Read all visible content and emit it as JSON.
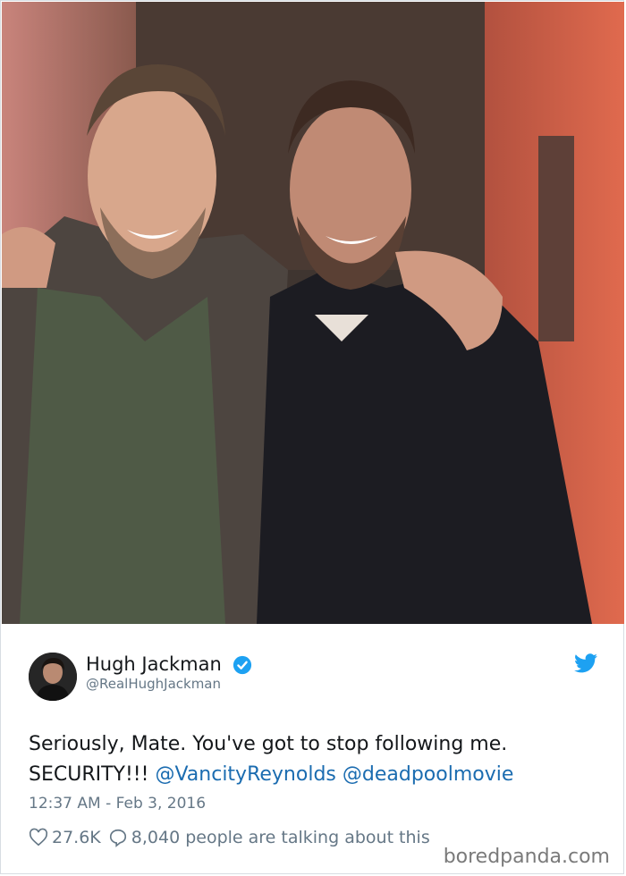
{
  "photo": {
    "alt_icon": "photo-two-men"
  },
  "tweet": {
    "display_name": "Hugh Jackman",
    "handle": "@RealHughJackman",
    "text_part1": "Seriously, Mate. You've got to stop following me.",
    "text_part2": "SECURITY!!!",
    "mention1": "@VancityReynolds",
    "mention2": "@deadpoolmovie",
    "timestamp": "12:37 AM - Feb 3, 2016",
    "likes": "27.6K",
    "replies": "8,040 people are talking about this",
    "verified_icon": "verified-badge-icon",
    "brand_icon": "twitter-bird-icon",
    "colors": {
      "link": "#1b6cb0",
      "muted": "#657786",
      "twitter_blue": "#1da1f2"
    }
  },
  "watermark": {
    "text": "boredpanda.com"
  }
}
